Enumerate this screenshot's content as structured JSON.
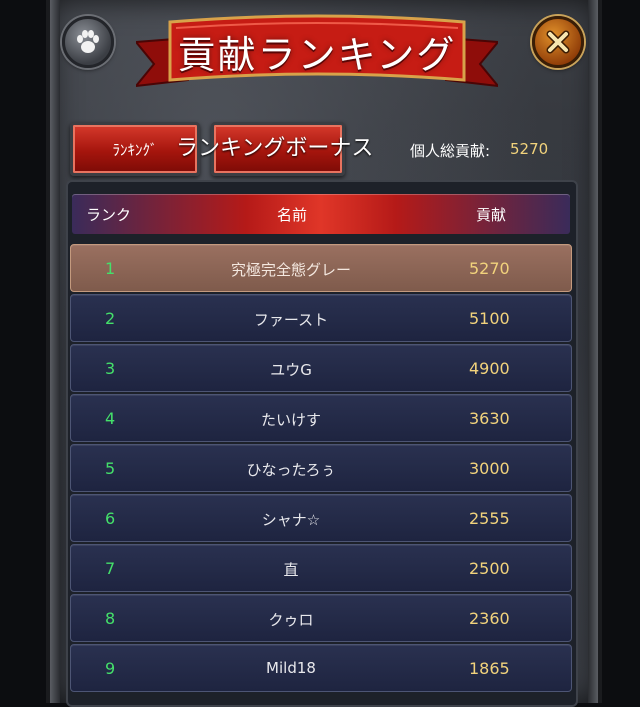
{
  "title": "貢献ランキング",
  "tabs": {
    "ranking_label": "ﾗﾝｷﾝｸﾞ",
    "bonus_label": "ランキングボーナス"
  },
  "contribution": {
    "label": "個人総貢献:",
    "value": "5270"
  },
  "table": {
    "headers": {
      "rank": "ランク",
      "name": "名前",
      "score": "貢献"
    },
    "rows": [
      {
        "rank": "1",
        "name": "究極完全態グレー",
        "score": "5270"
      },
      {
        "rank": "2",
        "name": "ファースト",
        "score": "5100"
      },
      {
        "rank": "3",
        "name": "ユウG",
        "score": "4900"
      },
      {
        "rank": "4",
        "name": "たいけす",
        "score": "3630"
      },
      {
        "rank": "5",
        "name": "ひなったろぅ",
        "score": "3000"
      },
      {
        "rank": "6",
        "name": "シャナ☆",
        "score": "2555"
      },
      {
        "rank": "7",
        "name": "直",
        "score": "2500"
      },
      {
        "rank": "8",
        "name": "クゥロ",
        "score": "2360"
      },
      {
        "rank": "9",
        "name": "Mild18",
        "score": "1865"
      }
    ]
  },
  "icons": {
    "left": "paw-icon",
    "right": "close-icon"
  },
  "colors": {
    "rank_text": "#44e06a",
    "score_text": "#f2d37c",
    "accent_red": "#b51a18",
    "highlight_row": "#9a7060"
  }
}
